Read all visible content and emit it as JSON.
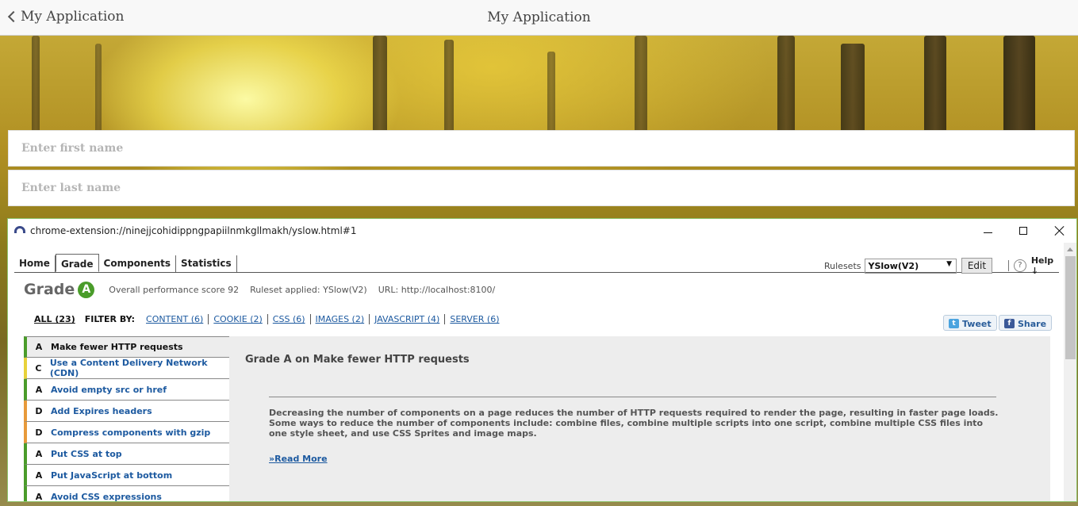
{
  "app": {
    "title": "My Application",
    "back_label": "My Application"
  },
  "form": {
    "first_name_placeholder": "Enter first name",
    "last_name_placeholder": "Enter last name"
  },
  "window": {
    "url": "chrome-extension://ninejjcohidippngpapiilnmkgllmakh/yslow.html#1"
  },
  "yslow": {
    "tabs": [
      "Home",
      "Grade",
      "Components",
      "Statistics"
    ],
    "active_tab": "Grade",
    "rulesets_label": "Rulesets",
    "ruleset_value": "YSlow(V2)",
    "edit_label": "Edit",
    "help_label": "Help ↓",
    "grade_label": "Grade",
    "grade_value": "A",
    "overall_score": "Overall performance score 92",
    "ruleset_applied": "Ruleset applied: YSlow(V2)",
    "url": "URL: http://localhost:8100/",
    "filter": {
      "all": "ALL (23)",
      "filter_by": "FILTER BY:",
      "links": [
        "CONTENT (6)",
        "COOKIE (2)",
        "CSS (6)",
        "IMAGES (2)",
        "JAVASCRIPT (4)",
        "SERVER (6)"
      ]
    },
    "tweet_label": "Tweet",
    "share_label": "Share",
    "rules": [
      {
        "grade": "A",
        "title": "Make fewer HTTP requests",
        "color": "#4a9c2a"
      },
      {
        "grade": "C",
        "title": "Use a Content Delivery Network (CDN)",
        "color": "#e8d23a"
      },
      {
        "grade": "A",
        "title": "Avoid empty src or href",
        "color": "#4a9c2a"
      },
      {
        "grade": "D",
        "title": "Add Expires headers",
        "color": "#e89a3a"
      },
      {
        "grade": "D",
        "title": "Compress components with gzip",
        "color": "#e89a3a"
      },
      {
        "grade": "A",
        "title": "Put CSS at top",
        "color": "#4a9c2a"
      },
      {
        "grade": "A",
        "title": "Put JavaScript at bottom",
        "color": "#4a9c2a"
      },
      {
        "grade": "A",
        "title": "Avoid CSS expressions",
        "color": "#4a9c2a"
      }
    ],
    "detail": {
      "title": "Grade A on Make fewer HTTP requests",
      "body": "Decreasing the number of components on a page reduces the number of HTTP requests required to render the page, resulting in faster page loads. Some ways to reduce the number of components include: combine files, combine multiple scripts into one script, combine multiple CSS files into one style sheet, and use CSS Sprites and image maps.",
      "read_more": "»Read More"
    }
  }
}
